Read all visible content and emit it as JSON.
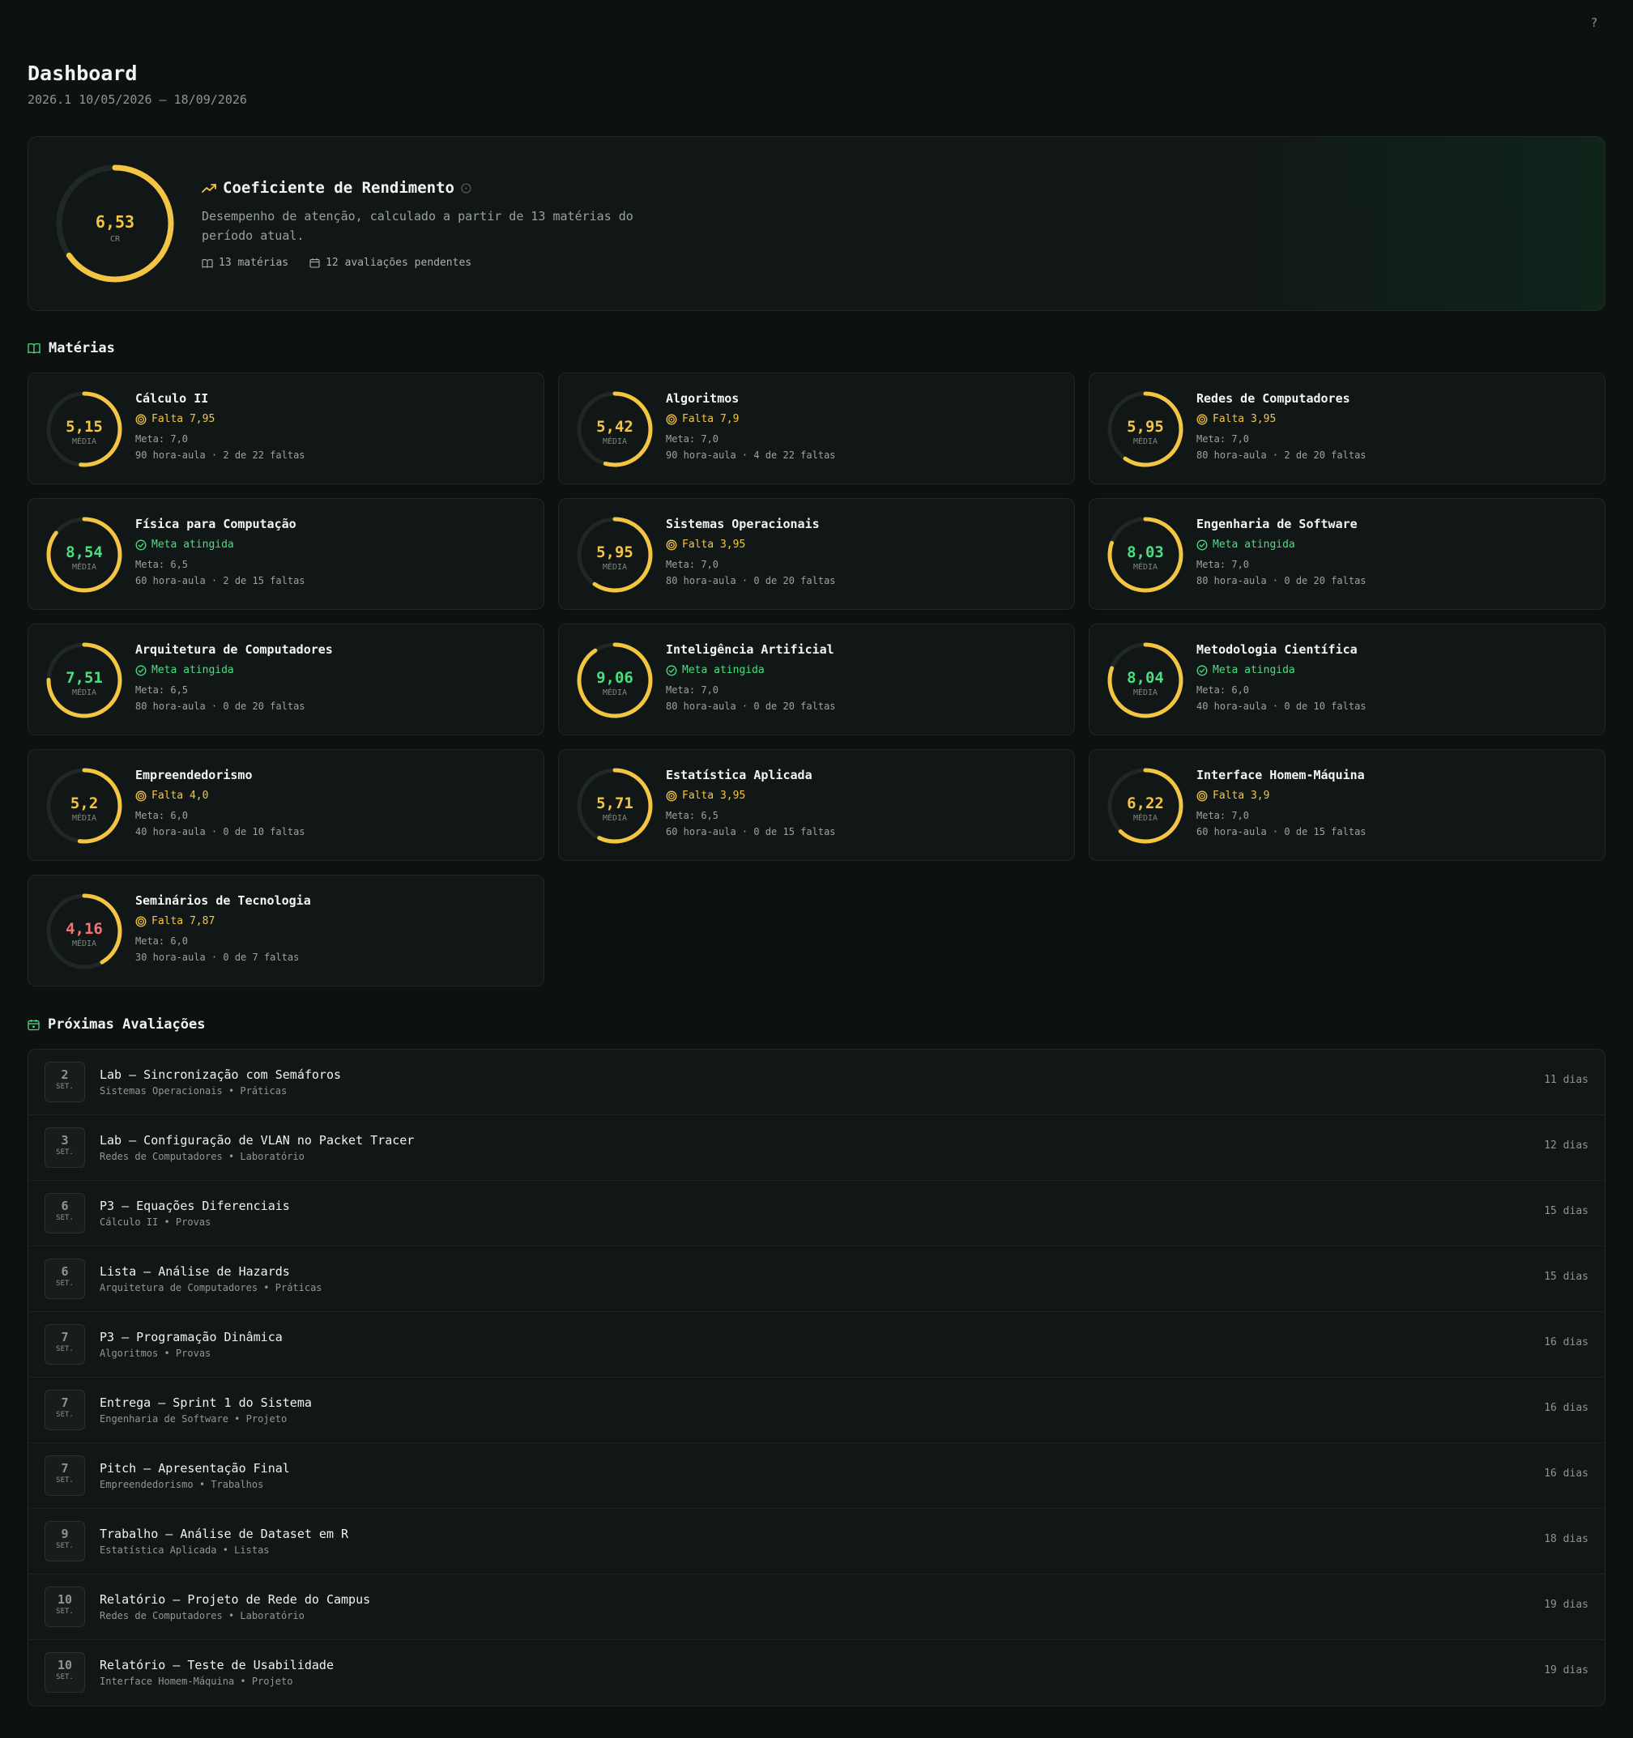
{
  "help": {
    "label": "?"
  },
  "header": {
    "title": "Dashboard",
    "subtitle": "2026.1 10/05/2026 — 18/09/2026"
  },
  "cr": {
    "value": "6,53",
    "value_num": 6.53,
    "label": "CR",
    "title": "Coeficiente de Rendimento",
    "description": "Desempenho de atenção, calculado a partir de 13 matérias do período atual.",
    "subjects_count": "13 matérias",
    "pending_count": "12 avaliações pendentes"
  },
  "sections": {
    "subjects": "Matérias",
    "evaluations": "Próximas Avaliações"
  },
  "colors": {
    "ring_track": "#1f2824",
    "ring_arc": "#f4c542",
    "value_warn": "#f4c542",
    "value_ok": "#4ade80",
    "value_bad": "#f87171",
    "accent_green": "#4ade80"
  },
  "subjects": [
    {
      "name": "Cálculo II",
      "grade": "5,15",
      "grade_num": 5.15,
      "state": "warn",
      "status": "Falta 7,95",
      "meta": "Meta: 7,0",
      "load": "90 hora-aula · 2 de 22 faltas",
      "grade_label": "MÉDIA"
    },
    {
      "name": "Algoritmos",
      "grade": "5,42",
      "grade_num": 5.42,
      "state": "warn",
      "status": "Falta 7,9",
      "meta": "Meta: 7,0",
      "load": "90 hora-aula · 4 de 22 faltas",
      "grade_label": "MÉDIA"
    },
    {
      "name": "Redes de Computadores",
      "grade": "5,95",
      "grade_num": 5.95,
      "state": "warn",
      "status": "Falta 3,95",
      "meta": "Meta: 7,0",
      "load": "80 hora-aula · 2 de 20 faltas",
      "grade_label": "MÉDIA"
    },
    {
      "name": "Física para Computação",
      "grade": "8,54",
      "grade_num": 8.54,
      "state": "ok",
      "status": "Meta atingida",
      "meta": "Meta: 6,5",
      "load": "60 hora-aula · 2 de 15 faltas",
      "grade_label": "MÉDIA"
    },
    {
      "name": "Sistemas Operacionais",
      "grade": "5,95",
      "grade_num": 5.95,
      "state": "warn",
      "status": "Falta 3,95",
      "meta": "Meta: 7,0",
      "load": "80 hora-aula · 0 de 20 faltas",
      "grade_label": "MÉDIA"
    },
    {
      "name": "Engenharia de Software",
      "grade": "8,03",
      "grade_num": 8.03,
      "state": "ok",
      "status": "Meta atingida",
      "meta": "Meta: 7,0",
      "load": "80 hora-aula · 0 de 20 faltas",
      "grade_label": "MÉDIA"
    },
    {
      "name": "Arquitetura de Computadores",
      "grade": "7,51",
      "grade_num": 7.51,
      "state": "ok",
      "status": "Meta atingida",
      "meta": "Meta: 6,5",
      "load": "80 hora-aula · 0 de 20 faltas",
      "grade_label": "MÉDIA"
    },
    {
      "name": "Inteligência Artificial",
      "grade": "9,06",
      "grade_num": 9.06,
      "state": "ok",
      "status": "Meta atingida",
      "meta": "Meta: 7,0",
      "load": "80 hora-aula · 0 de 20 faltas",
      "grade_label": "MÉDIA"
    },
    {
      "name": "Metodologia Científica",
      "grade": "8,04",
      "grade_num": 8.04,
      "state": "ok",
      "status": "Meta atingida",
      "meta": "Meta: 6,0",
      "load": "40 hora-aula · 0 de 10 faltas",
      "grade_label": "MÉDIA"
    },
    {
      "name": "Empreendedorismo",
      "grade": "5,2",
      "grade_num": 5.2,
      "state": "warn",
      "status": "Falta 4,0",
      "meta": "Meta: 6,0",
      "load": "40 hora-aula · 0 de 10 faltas",
      "grade_label": "MÉDIA"
    },
    {
      "name": "Estatística Aplicada",
      "grade": "5,71",
      "grade_num": 5.71,
      "state": "warn",
      "status": "Falta 3,95",
      "meta": "Meta: 6,5",
      "load": "60 hora-aula · 0 de 15 faltas",
      "grade_label": "MÉDIA"
    },
    {
      "name": "Interface Homem-Máquina",
      "grade": "6,22",
      "grade_num": 6.22,
      "state": "warn",
      "status": "Falta 3,9",
      "meta": "Meta: 7,0",
      "load": "60 hora-aula · 0 de 15 faltas",
      "grade_label": "MÉDIA"
    },
    {
      "name": "Seminários de Tecnologia",
      "grade": "4,16",
      "grade_num": 4.16,
      "state": "bad",
      "status": "Falta 7,87",
      "meta": "Meta: 6,0",
      "load": "30 hora-aula · 0 de 7 faltas",
      "grade_label": "MÉDIA"
    }
  ],
  "evaluations": [
    {
      "day": "2",
      "month": "SET.",
      "title": "Lab — Sincronização com Semáforos",
      "subtitle": "Sistemas Operacionais • Práticas",
      "remaining": "11 dias"
    },
    {
      "day": "3",
      "month": "SET.",
      "title": "Lab — Configuração de VLAN no Packet Tracer",
      "subtitle": "Redes de Computadores • Laboratório",
      "remaining": "12 dias"
    },
    {
      "day": "6",
      "month": "SET.",
      "title": "P3 — Equações Diferenciais",
      "subtitle": "Cálculo II • Provas",
      "remaining": "15 dias"
    },
    {
      "day": "6",
      "month": "SET.",
      "title": "Lista — Análise de Hazards",
      "subtitle": "Arquitetura de Computadores • Práticas",
      "remaining": "15 dias"
    },
    {
      "day": "7",
      "month": "SET.",
      "title": "P3 — Programação Dinâmica",
      "subtitle": "Algoritmos • Provas",
      "remaining": "16 dias"
    },
    {
      "day": "7",
      "month": "SET.",
      "title": "Entrega — Sprint 1 do Sistema",
      "subtitle": "Engenharia de Software • Projeto",
      "remaining": "16 dias"
    },
    {
      "day": "7",
      "month": "SET.",
      "title": "Pitch — Apresentação Final",
      "subtitle": "Empreendedorismo • Trabalhos",
      "remaining": "16 dias"
    },
    {
      "day": "9",
      "month": "SET.",
      "title": "Trabalho — Análise de Dataset em R",
      "subtitle": "Estatística Aplicada • Listas",
      "remaining": "18 dias"
    },
    {
      "day": "10",
      "month": "SET.",
      "title": "Relatório — Projeto de Rede do Campus",
      "subtitle": "Redes de Computadores • Laboratório",
      "remaining": "19 dias"
    },
    {
      "day": "10",
      "month": "SET.",
      "title": "Relatório — Teste de Usabilidade",
      "subtitle": "Interface Homem-Máquina • Projeto",
      "remaining": "19 dias"
    }
  ]
}
